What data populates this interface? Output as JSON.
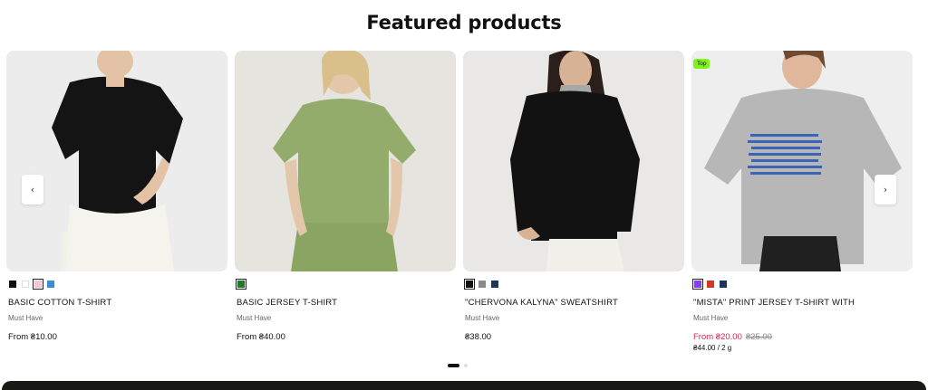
{
  "section": {
    "title": "Featured products"
  },
  "navigation": {
    "prev_icon": "‹",
    "next_icon": "›"
  },
  "products": [
    {
      "name": "BASIC COTTON T-SHIRT",
      "vendor": "Must Have",
      "price": "From ₴10.00",
      "swatches": [
        "#111111",
        "#ffffff",
        "#f4c6cf",
        "#3a8fcf"
      ],
      "selected_swatch": 2
    },
    {
      "name": "BASIC JERSEY T-SHIRT",
      "vendor": "Must Have",
      "price": "From ₴40.00",
      "swatches": [
        "#1d7a2a"
      ],
      "selected_swatch": 0
    },
    {
      "name": "\"CHERVONA KALYNA\" SWEATSHIRT",
      "vendor": "Must Have",
      "price": "₴38.00",
      "swatches": [
        "#111111",
        "#8a8a8a",
        "#1e3460"
      ],
      "selected_swatch": 0
    },
    {
      "name": "\"MISTA\" PRINT JERSEY T-SHIRT WITH",
      "vendor": "Must Have",
      "sale_price": "From ₴20.00",
      "compare_price": "₴25.00",
      "unit_price": "₴44.00 / 2 g",
      "badge": "Top",
      "swatches": [
        "#8a3df0",
        "#d5362b",
        "#1e3460"
      ],
      "selected_swatch": 0
    }
  ],
  "pagination": {
    "active_index": 0,
    "count": 2
  },
  "colors": {
    "sale": "#d9265c",
    "badge": "#7ef51a",
    "footer": "#181a15"
  }
}
